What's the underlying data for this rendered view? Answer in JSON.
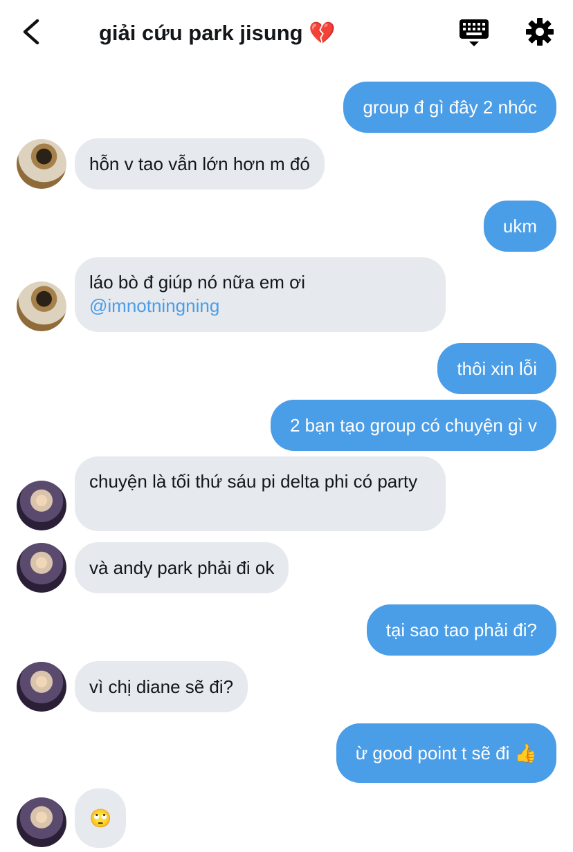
{
  "header": {
    "title": "giải cứu park jisung 💔",
    "back_icon": "chevron-left-icon",
    "keyboard_icon": "keyboard-icon",
    "settings_icon": "gear-icon"
  },
  "messages": [
    {
      "side": "out",
      "text": "group đ gì đây 2 nhóc"
    },
    {
      "side": "in",
      "text": "hỗn v tao vẫn lớn hơn m đó"
    },
    {
      "side": "out",
      "text": "ukm"
    },
    {
      "side": "in",
      "text": "láo bò đ giúp nó nữa em ơi",
      "mention": "@imnotningning"
    },
    {
      "side": "out",
      "text": "thôi xin lỗi"
    },
    {
      "side": "out",
      "text": "2 bạn tạo group có chuyện gì v"
    },
    {
      "side": "in",
      "text": "chuyện là tối thứ sáu pi delta phi có party"
    },
    {
      "side": "in",
      "text": "và andy park phải đi ok"
    },
    {
      "side": "out",
      "text": "tại sao tao phải đi?"
    },
    {
      "side": "in",
      "text": "vì chị diane sẽ đi?"
    },
    {
      "side": "out",
      "text": "ừ good point t sẽ đi 👍"
    },
    {
      "side": "in",
      "text": "🙄"
    }
  ],
  "colors": {
    "outgoing_bubble": "#4a9de7",
    "incoming_bubble": "#e6e9ee",
    "mention": "#4a9de7",
    "text_dark": "#14171a"
  }
}
